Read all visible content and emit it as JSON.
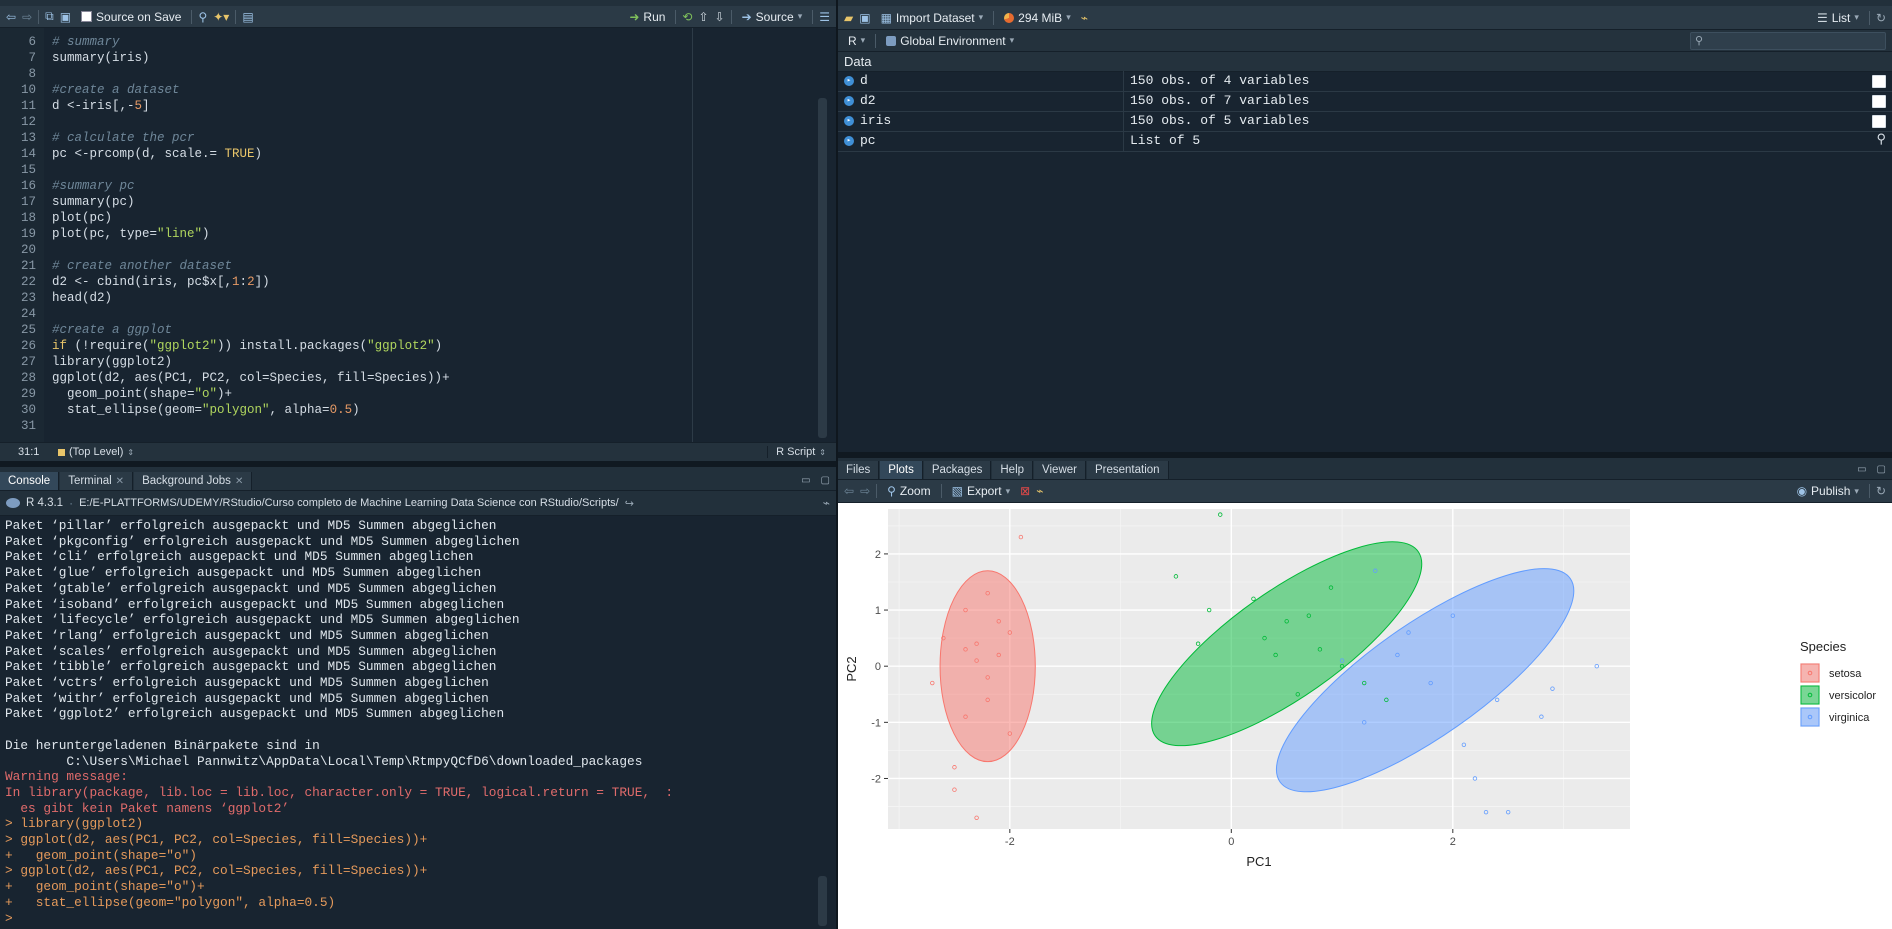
{
  "editor": {
    "toolbar": {
      "source_on_save": "Source on Save",
      "run": "Run",
      "source": "Source"
    },
    "lines": [
      {
        "n": "6",
        "t": "# summary",
        "k": "cm"
      },
      {
        "n": "7",
        "t": "summary(iris)",
        "k": "op"
      },
      {
        "n": "8",
        "t": "",
        "k": "op"
      },
      {
        "n": "10",
        "t": "#create a dataset",
        "k": "cm"
      },
      {
        "n": "11",
        "t": "d <-iris[,-5]",
        "k": "op"
      },
      {
        "n": "12",
        "t": "",
        "k": "op"
      },
      {
        "n": "13",
        "t": "# calculate the pcr",
        "k": "cm"
      },
      {
        "n": "14",
        "t": "pc <-prcomp(d, scale.= TRUE)",
        "k": "op"
      },
      {
        "n": "15",
        "t": "",
        "k": "op"
      },
      {
        "n": "16",
        "t": "#summary pc",
        "k": "cm"
      },
      {
        "n": "17",
        "t": "summary(pc)",
        "k": "op"
      },
      {
        "n": "18",
        "t": "plot(pc)",
        "k": "op"
      },
      {
        "n": "19",
        "t": "plot(pc, type=\"line\")",
        "k": "op"
      },
      {
        "n": "20",
        "t": "",
        "k": "op"
      },
      {
        "n": "21",
        "t": "# create another dataset",
        "k": "cm"
      },
      {
        "n": "22",
        "t": "d2 <- cbind(iris, pc$x[,1:2])",
        "k": "op"
      },
      {
        "n": "23",
        "t": "head(d2)",
        "k": "op"
      },
      {
        "n": "24",
        "t": "",
        "k": "op"
      },
      {
        "n": "25",
        "t": "#create a ggplot",
        "k": "cm"
      },
      {
        "n": "26",
        "t": "if (!require(\"ggplot2\")) install.packages(\"ggplot2\")",
        "k": "op"
      },
      {
        "n": "27",
        "t": "library(ggplot2)",
        "k": "op"
      },
      {
        "n": "28",
        "t": "ggplot(d2, aes(PC1, PC2, col=Species, fill=Species))+",
        "k": "op"
      },
      {
        "n": "29",
        "t": "  geom_point(shape=\"o\")+",
        "k": "op"
      },
      {
        "n": "30",
        "t": "  stat_ellipse(geom=\"polygon\", alpha=0.5)",
        "k": "op"
      },
      {
        "n": "31",
        "t": "",
        "k": "op"
      }
    ],
    "status": {
      "position": "31:1",
      "scope": "(Top Level)",
      "file_type": "R Script"
    }
  },
  "console": {
    "tabs": [
      "Console",
      "Terminal",
      "Background Jobs"
    ],
    "r_version": "R 4.3.1",
    "path": "E:/E-PLATTFORMS/UDEMY/RStudio/Curso completo de Machine Learning Data Science con RStudio/Scripts/",
    "lines": [
      {
        "t": "Paket ‘pillar’ erfolgreich ausgepackt und MD5 Summen abgeglichen",
        "k": "c-out"
      },
      {
        "t": "Paket ‘pkgconfig’ erfolgreich ausgepackt und MD5 Summen abgeglichen",
        "k": "c-out"
      },
      {
        "t": "Paket ‘cli’ erfolgreich ausgepackt und MD5 Summen abgeglichen",
        "k": "c-out"
      },
      {
        "t": "Paket ‘glue’ erfolgreich ausgepackt und MD5 Summen abgeglichen",
        "k": "c-out"
      },
      {
        "t": "Paket ‘gtable’ erfolgreich ausgepackt und MD5 Summen abgeglichen",
        "k": "c-out"
      },
      {
        "t": "Paket ‘isoband’ erfolgreich ausgepackt und MD5 Summen abgeglichen",
        "k": "c-out"
      },
      {
        "t": "Paket ‘lifecycle’ erfolgreich ausgepackt und MD5 Summen abgeglichen",
        "k": "c-out"
      },
      {
        "t": "Paket ‘rlang’ erfolgreich ausgepackt und MD5 Summen abgeglichen",
        "k": "c-out"
      },
      {
        "t": "Paket ‘scales’ erfolgreich ausgepackt und MD5 Summen abgeglichen",
        "k": "c-out"
      },
      {
        "t": "Paket ‘tibble’ erfolgreich ausgepackt und MD5 Summen abgeglichen",
        "k": "c-out"
      },
      {
        "t": "Paket ‘vctrs’ erfolgreich ausgepackt und MD5 Summen abgeglichen",
        "k": "c-out"
      },
      {
        "t": "Paket ‘withr’ erfolgreich ausgepackt und MD5 Summen abgeglichen",
        "k": "c-out"
      },
      {
        "t": "Paket ‘ggplot2’ erfolgreich ausgepackt und MD5 Summen abgeglichen",
        "k": "c-out"
      },
      {
        "t": "",
        "k": "c-out"
      },
      {
        "t": "Die heruntergeladenen Binärpakete sind in",
        "k": "c-out"
      },
      {
        "t": "        C:\\Users\\Michael Pannwitz\\AppData\\Local\\Temp\\RtmpyQCfD6\\downloaded_packages",
        "k": "c-out"
      },
      {
        "t": "Warning message:",
        "k": "c-warn"
      },
      {
        "t": "In library(package, lib.loc = lib.loc, character.only = TRUE, logical.return = TRUE,  :",
        "k": "c-warn"
      },
      {
        "t": "  es gibt kein Paket namens ‘ggplot2’",
        "k": "c-warn"
      },
      {
        "t": "> library(ggplot2)",
        "k": "c-cmd"
      },
      {
        "t": "> ggplot(d2, aes(PC1, PC2, col=Species, fill=Species))+",
        "k": "c-cmd"
      },
      {
        "t": "+   geom_point(shape=\"o\")",
        "k": "c-cmd"
      },
      {
        "t": "> ggplot(d2, aes(PC1, PC2, col=Species, fill=Species))+",
        "k": "c-cmd"
      },
      {
        "t": "+   geom_point(shape=\"o\")+",
        "k": "c-cmd"
      },
      {
        "t": "+   stat_ellipse(geom=\"polygon\", alpha=0.5)",
        "k": "c-cmd"
      },
      {
        "t": ">",
        "k": "c-cmd"
      }
    ]
  },
  "environment": {
    "toolbar": {
      "import_dataset": "Import Dataset",
      "memory": "294 MiB",
      "view_mode": "List"
    },
    "lang": "R",
    "scope": "Global Environment",
    "section": "Data",
    "rows": [
      {
        "name": "d",
        "value": "150 obs. of 4 variables"
      },
      {
        "name": "d2",
        "value": "150 obs. of 7 variables"
      },
      {
        "name": "iris",
        "value": "150 obs. of 5 variables"
      },
      {
        "name": "pc",
        "value": "List of  5"
      }
    ]
  },
  "plots_pane": {
    "tabs": [
      "Files",
      "Plots",
      "Packages",
      "Help",
      "Viewer",
      "Presentation"
    ],
    "active_tab": "Plots",
    "toolbar": {
      "zoom": "Zoom",
      "export": "Export",
      "publish": "Publish"
    }
  },
  "chart_data": {
    "type": "scatter",
    "xlabel": "PC1",
    "ylabel": "PC2",
    "xlim": [
      -3.1,
      3.6
    ],
    "ylim": [
      -2.9,
      2.8
    ],
    "xticks": [
      -2,
      0,
      2
    ],
    "yticks": [
      -2,
      -1,
      0,
      1,
      2
    ],
    "grid": true,
    "legend_title": "Species",
    "legend_position": "right",
    "series": [
      {
        "name": "setosa",
        "color": "#f8766d",
        "ellipse": {
          "cx": -2.2,
          "cy": 0,
          "rx": 0.43,
          "ry": 1.7,
          "angle": 0
        },
        "points": [
          [
            -2.7,
            -0.3
          ],
          [
            -2.4,
            1.0
          ],
          [
            -2.3,
            0.4
          ],
          [
            -2.1,
            0.8
          ],
          [
            -2.5,
            -1.8
          ],
          [
            -2.2,
            -0.6
          ],
          [
            -2.3,
            0.1
          ],
          [
            -2.6,
            0.5
          ],
          [
            -2.0,
            -1.2
          ],
          [
            -2.2,
            1.3
          ],
          [
            -2.4,
            -0.9
          ],
          [
            -2.1,
            0.2
          ],
          [
            -2.3,
            -2.7
          ],
          [
            -1.9,
            2.3
          ],
          [
            -2.5,
            -2.2
          ],
          [
            -2.2,
            -0.2
          ],
          [
            -2.4,
            0.3
          ],
          [
            -2.0,
            0.6
          ]
        ]
      },
      {
        "name": "versicolor",
        "color": "#00ba38",
        "ellipse": {
          "cx": 0.5,
          "cy": 0.4,
          "rx": 1.45,
          "ry": 0.95,
          "angle": -35
        },
        "points": [
          [
            -0.1,
            2.7
          ],
          [
            -0.5,
            1.6
          ],
          [
            0.2,
            1.2
          ],
          [
            0.5,
            0.8
          ],
          [
            0.8,
            0.3
          ],
          [
            1.0,
            0.0
          ],
          [
            0.3,
            0.5
          ],
          [
            -0.2,
            1.0
          ],
          [
            0.6,
            -0.5
          ],
          [
            1.2,
            -0.3
          ],
          [
            0.9,
            1.4
          ],
          [
            0.4,
            0.2
          ],
          [
            -0.3,
            0.4
          ],
          [
            0.7,
            0.9
          ],
          [
            1.4,
            -0.6
          ]
        ]
      },
      {
        "name": "virginica",
        "color": "#619cff",
        "ellipse": {
          "cx": 1.75,
          "cy": -0.25,
          "rx": 1.6,
          "ry": 1.0,
          "angle": -35
        },
        "points": [
          [
            1.3,
            1.7
          ],
          [
            2.0,
            0.9
          ],
          [
            1.5,
            0.2
          ],
          [
            2.4,
            -0.6
          ],
          [
            2.8,
            -0.9
          ],
          [
            1.8,
            -0.3
          ],
          [
            1.2,
            -1.0
          ],
          [
            2.2,
            -2.0
          ],
          [
            3.3,
            0.0
          ],
          [
            2.5,
            -2.6
          ],
          [
            2.9,
            -0.4
          ],
          [
            1.6,
            0.6
          ],
          [
            2.1,
            -1.4
          ],
          [
            1.0,
            0.1
          ],
          [
            2.3,
            -2.6
          ]
        ]
      }
    ]
  }
}
